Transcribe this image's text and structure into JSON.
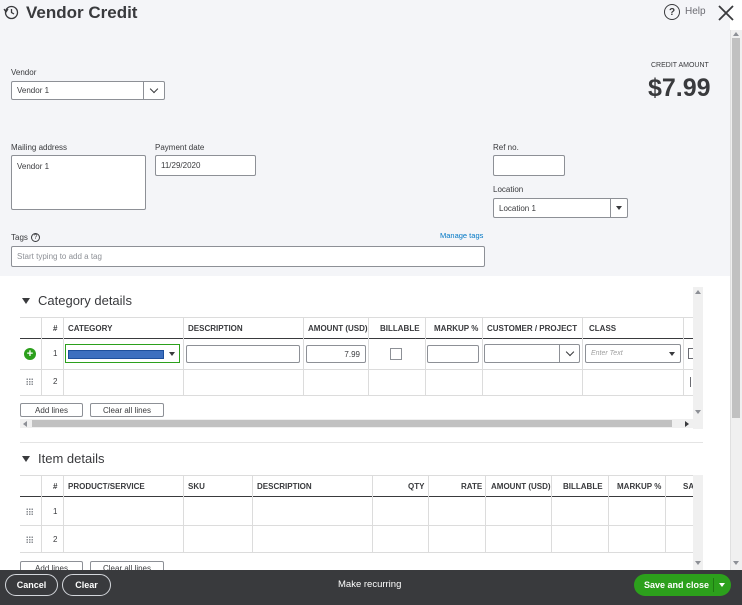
{
  "header": {
    "title": "Vendor Credit",
    "help_label": "Help"
  },
  "credit": {
    "label": "CREDIT AMOUNT",
    "amount": "$7.99"
  },
  "vendor": {
    "label": "Vendor",
    "value": "Vendor 1"
  },
  "mailing": {
    "label": "Mailing address",
    "value": "Vendor 1"
  },
  "payment_date": {
    "label": "Payment date",
    "value": "11/29/2020"
  },
  "ref": {
    "label": "Ref no.",
    "value": ""
  },
  "location": {
    "label": "Location",
    "value": "Location 1"
  },
  "tags": {
    "label": "Tags",
    "manage": "Manage tags",
    "placeholder": "Start typing to add a tag"
  },
  "category": {
    "title": "Category details",
    "columns": {
      "num": "#",
      "category": "CATEGORY",
      "description": "DESCRIPTION",
      "amount": "AMOUNT (USD)",
      "billable": "BILLABLE",
      "markup": "MARKUP %",
      "customer": "CUSTOMER / PROJECT",
      "class": "CLASS"
    },
    "rows": [
      {
        "num": "1",
        "amount": "7.99",
        "class_placeholder": "Enter Text"
      },
      {
        "num": "2"
      }
    ],
    "add_lines": "Add lines",
    "clear_lines": "Clear all lines"
  },
  "item": {
    "title": "Item details",
    "columns": {
      "num": "#",
      "product": "PRODUCT/SERVICE",
      "sku": "SKU",
      "description": "DESCRIPTION",
      "qty": "QTY",
      "rate": "RATE",
      "amount": "AMOUNT (USD)",
      "billable": "BILLABLE",
      "markup": "MARKUP %",
      "sales_tax": "SA"
    },
    "rows": [
      {
        "num": "1"
      },
      {
        "num": "2"
      }
    ],
    "add_lines": "Add lines",
    "clear_lines": "Clear all lines"
  },
  "footer": {
    "cancel": "Cancel",
    "clear": "Clear",
    "recurring": "Make recurring",
    "save": "Save and close"
  },
  "colors": {
    "accent": "#2ca01c",
    "footer_bg": "#393a3d",
    "selection": "#3c6fbf",
    "link": "#0077c5"
  }
}
